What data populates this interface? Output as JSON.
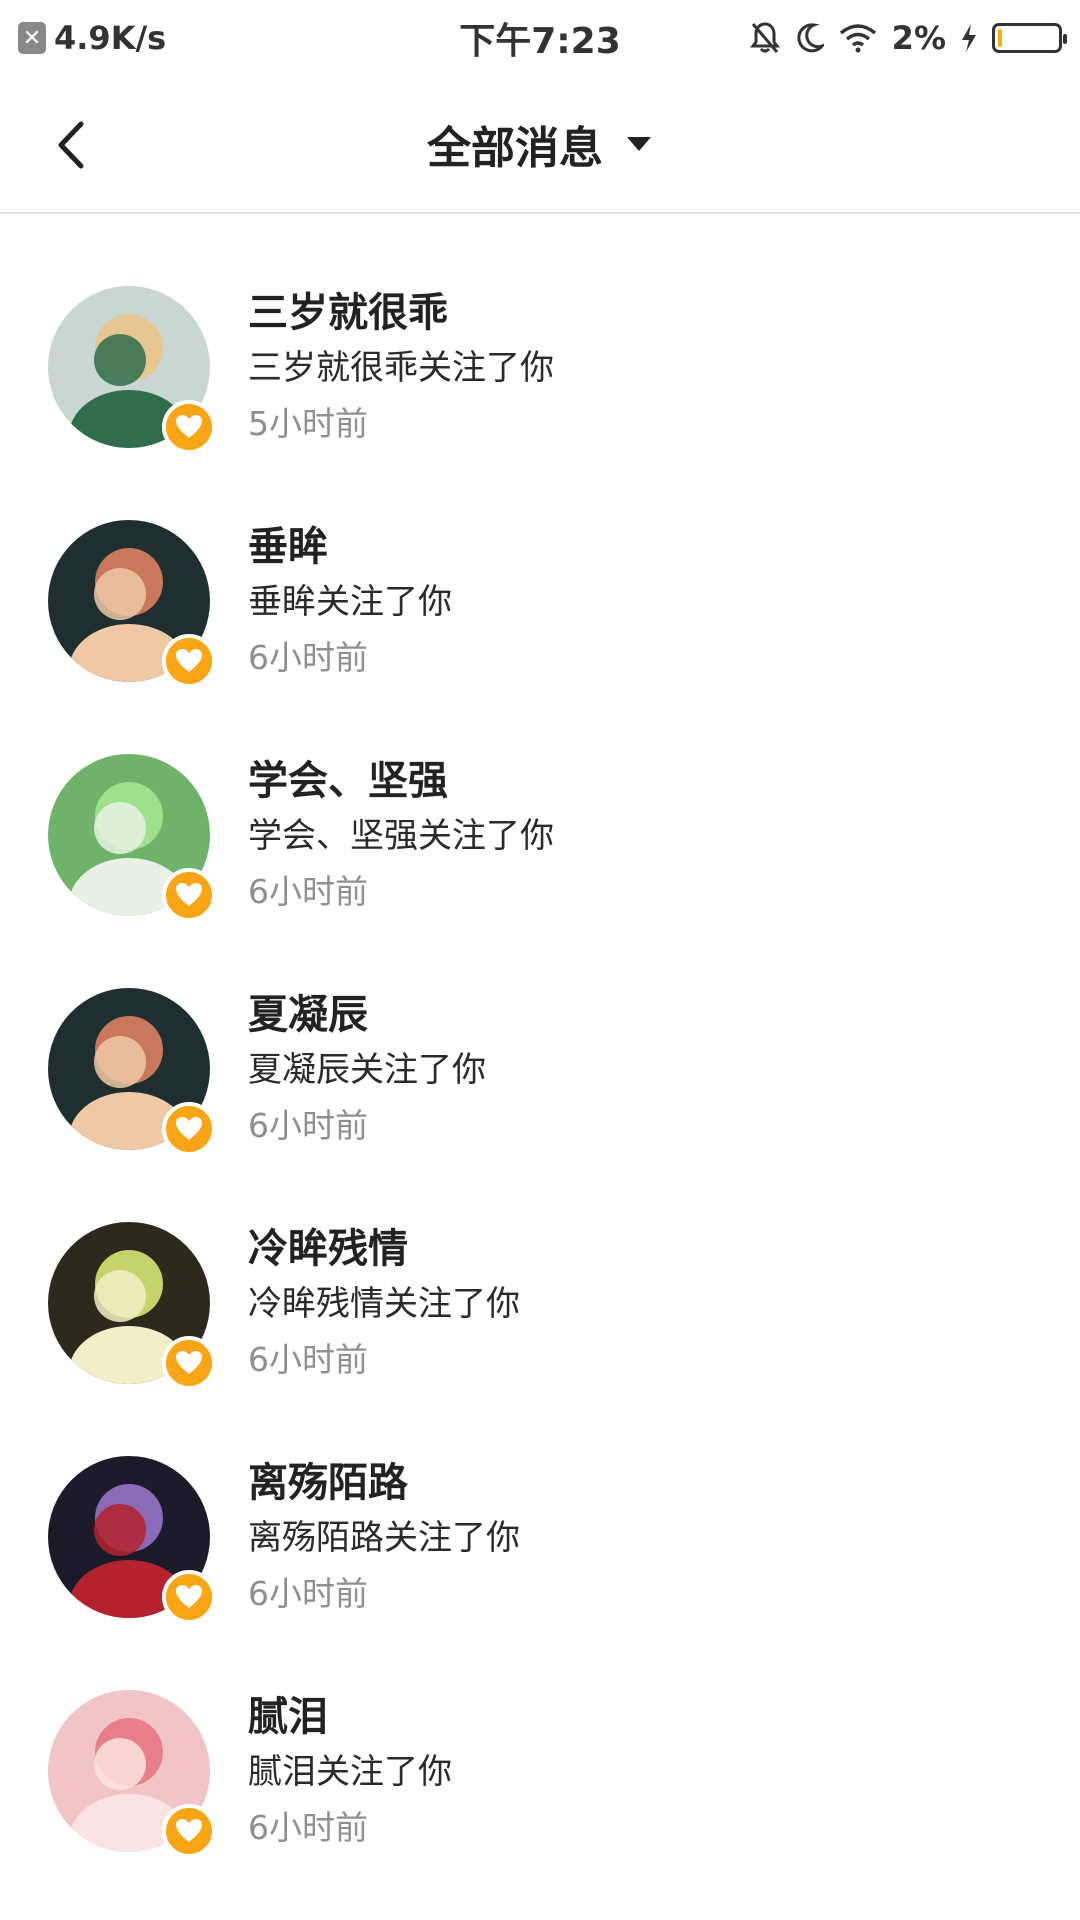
{
  "status_bar": {
    "net_speed": "4.9K/s",
    "time": "下午7:23",
    "battery": "2%",
    "icons": [
      "notifications-off-icon",
      "moon-icon",
      "wifi-icon",
      "charging-icon",
      "battery-icon"
    ]
  },
  "nav": {
    "title": "全部消息",
    "back_icon": "chevron-left-icon",
    "dropdown_icon": "triangle-down-icon"
  },
  "accent_color": "#f9a515",
  "messages": [
    {
      "name": "三岁就很乖",
      "text": "三岁就很乖关注了你",
      "time": "5小时前",
      "avatar_colors": [
        "#c9d6d3",
        "#e6c792",
        "#2f6d4c"
      ]
    },
    {
      "name": "垂眸",
      "text": "垂眸关注了你",
      "time": "6小时前",
      "avatar_colors": [
        "#1f2e2f",
        "#c9785c",
        "#efc9a6"
      ]
    },
    {
      "name": "学会、坚强",
      "text": "学会、坚强关注了你",
      "time": "6小时前",
      "avatar_colors": [
        "#6fb36a",
        "#9fe08c",
        "#e8f1e6"
      ]
    },
    {
      "name": "夏凝辰",
      "text": "夏凝辰关注了你",
      "time": "6小时前",
      "avatar_colors": [
        "#1f2e2f",
        "#c9785c",
        "#efc9a6"
      ]
    },
    {
      "name": "冷眸残情",
      "text": "冷眸残情关注了你",
      "time": "6小时前",
      "avatar_colors": [
        "#2b2a1c",
        "#c4d36a",
        "#f2efc6"
      ]
    },
    {
      "name": "离殇陌路",
      "text": "离殇陌路关注了你",
      "time": "6小时前",
      "avatar_colors": [
        "#1b1b2b",
        "#8b6bb8",
        "#b3232c"
      ]
    },
    {
      "name": "腻泪",
      "text": "腻泪关注了你",
      "time": "6小时前",
      "avatar_colors": [
        "#f1c4c6",
        "#e87f88",
        "#fbe3e1"
      ]
    }
  ]
}
